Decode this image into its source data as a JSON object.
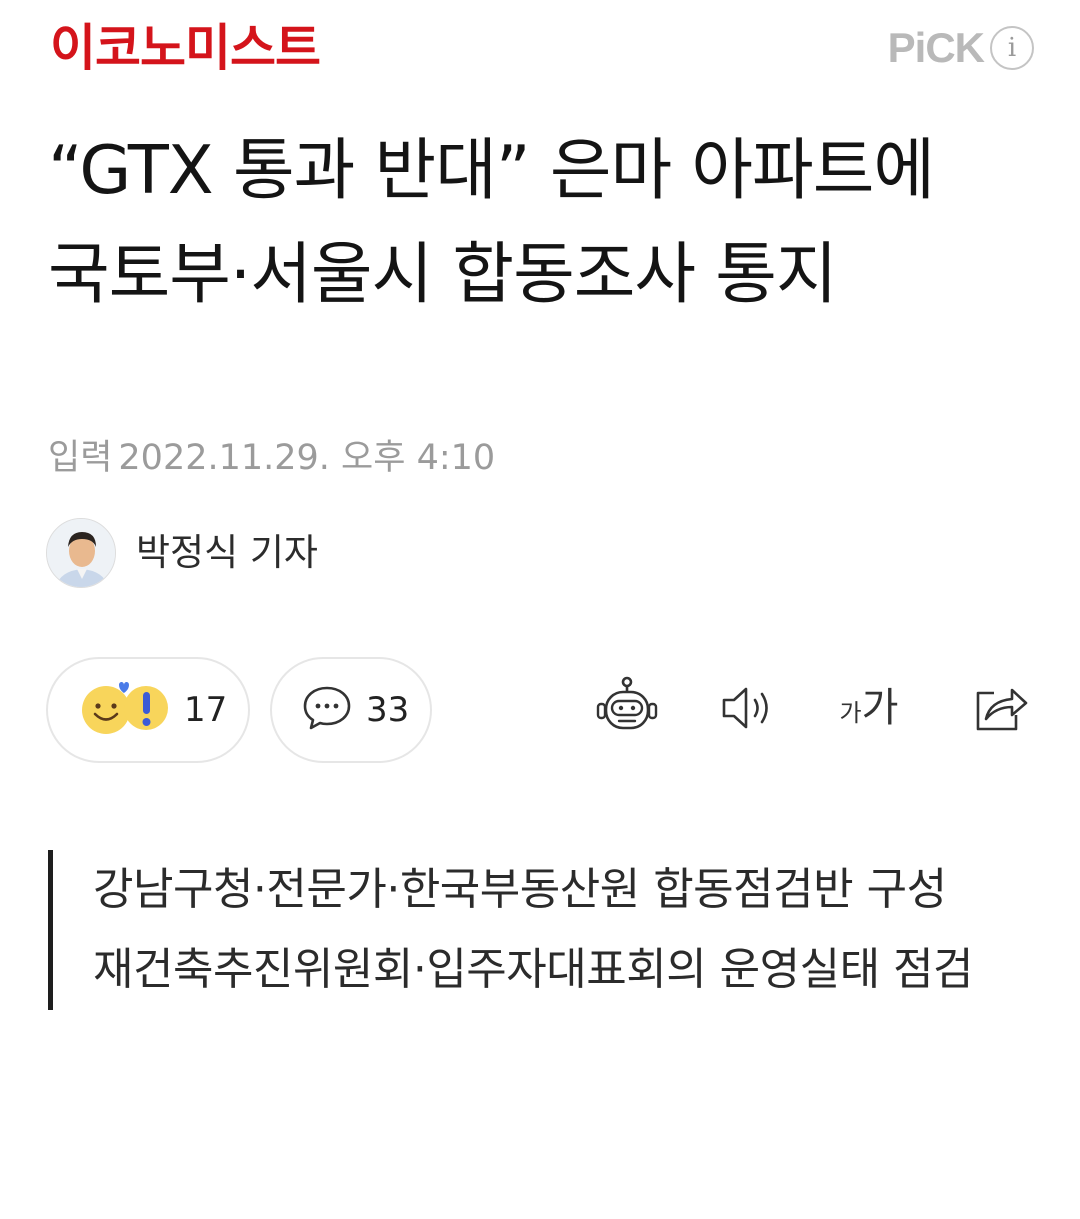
{
  "header": {
    "press_name": "이코노미스트",
    "pick_label": "PiCK",
    "info_label": "i",
    "press_color": "#d4141b"
  },
  "article": {
    "title": "“GTX 통과 반대” 은마 아파트에 국토부·서울시 합동조사 통지",
    "date_label": "입력",
    "date_value": "2022.11.29. 오후 4:10",
    "reporter": "박정식 기자"
  },
  "actions": {
    "reaction_icon": "reaction-emoji-icon",
    "reaction_count": "17",
    "comment_icon": "speech-bubble-icon",
    "comment_count": "33",
    "tools": [
      "robot-summary-icon",
      "speaker-icon",
      "font-size-icon",
      "share-icon"
    ],
    "font_size_small": "가",
    "font_size_large": "가"
  },
  "summary": {
    "lines": [
      "강남구청·전문가·한국부동산원 합동점검반 구성",
      "재건축추진위원회·입주자대표회의 운영실태 점검"
    ]
  }
}
